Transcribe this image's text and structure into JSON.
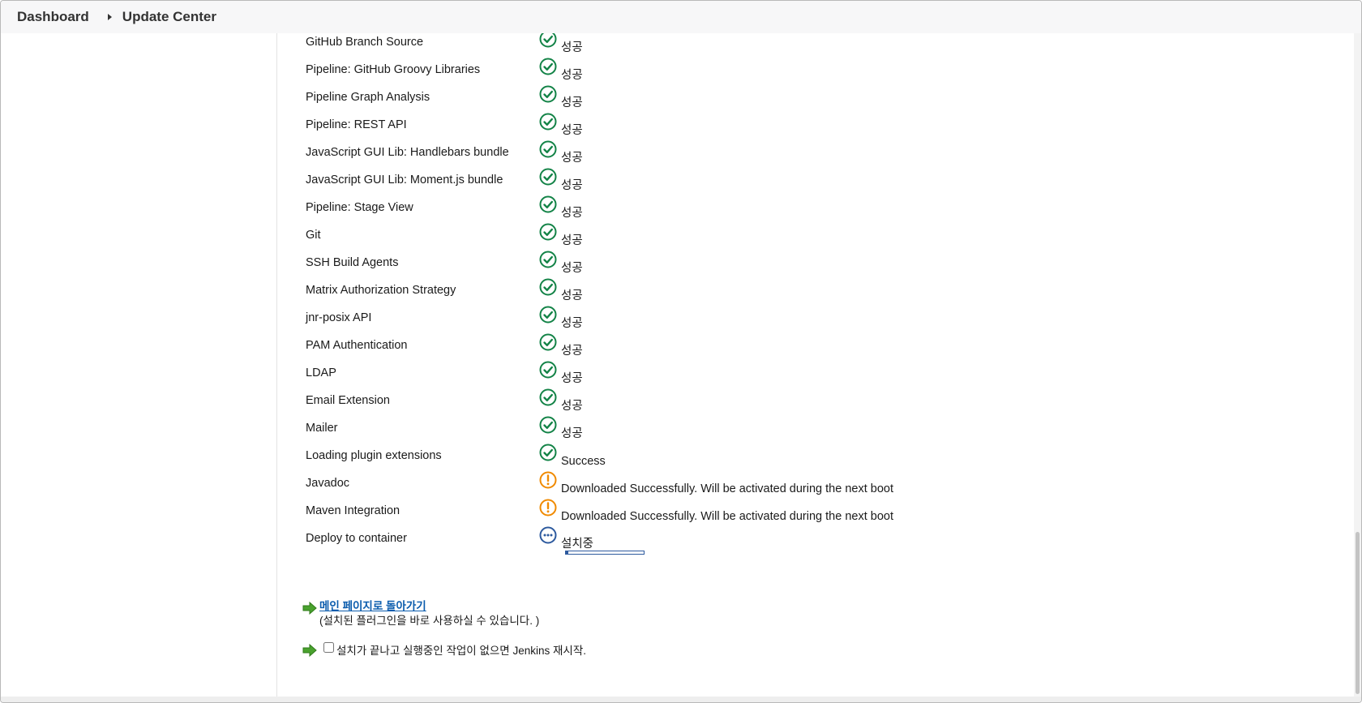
{
  "breadcrumb": {
    "dashboard": "Dashboard",
    "update_center": "Update Center"
  },
  "colors": {
    "success": "#138347",
    "warning": "#f08a00",
    "installing": "#2d5a9e",
    "link": "#0b5cad",
    "arrow": "#4aa22e"
  },
  "plugins": [
    {
      "name": "GitHub Branch Source",
      "status": "success",
      "status_text": "성공"
    },
    {
      "name": "Pipeline: GitHub Groovy Libraries",
      "status": "success",
      "status_text": "성공"
    },
    {
      "name": "Pipeline Graph Analysis",
      "status": "success",
      "status_text": "성공"
    },
    {
      "name": "Pipeline: REST API",
      "status": "success",
      "status_text": "성공"
    },
    {
      "name": "JavaScript GUI Lib: Handlebars bundle",
      "status": "success",
      "status_text": "성공"
    },
    {
      "name": "JavaScript GUI Lib: Moment.js bundle",
      "status": "success",
      "status_text": "성공"
    },
    {
      "name": "Pipeline: Stage View",
      "status": "success",
      "status_text": "성공"
    },
    {
      "name": "Git",
      "status": "success",
      "status_text": "성공"
    },
    {
      "name": "SSH Build Agents",
      "status": "success",
      "status_text": "성공"
    },
    {
      "name": "Matrix Authorization Strategy",
      "status": "success",
      "status_text": "성공"
    },
    {
      "name": "jnr-posix API",
      "status": "success",
      "status_text": "성공"
    },
    {
      "name": "PAM Authentication",
      "status": "success",
      "status_text": "성공"
    },
    {
      "name": "LDAP",
      "status": "success",
      "status_text": "성공"
    },
    {
      "name": "Email Extension",
      "status": "success",
      "status_text": "성공"
    },
    {
      "name": "Mailer",
      "status": "success",
      "status_text": "성공"
    },
    {
      "name": "Loading plugin extensions",
      "status": "success",
      "status_text": "Success"
    },
    {
      "name": "Javadoc",
      "status": "warning",
      "status_text": "Downloaded Successfully. Will be activated during the next boot"
    },
    {
      "name": "Maven Integration",
      "status": "warning",
      "status_text": "Downloaded Successfully. Will be activated during the next boot"
    },
    {
      "name": "Deploy to container",
      "status": "installing",
      "status_text": "설치중",
      "progress": 0.03
    }
  ],
  "actions": {
    "back_link": "메인 페이지로 돌아가기",
    "back_note": "(설치된 플러그인을 바로 사용하실 수 있습니다. )",
    "restart_label": "설치가 끝나고 실행중인 작업이 없으면 Jenkins 재시작.",
    "restart_checked": false
  }
}
